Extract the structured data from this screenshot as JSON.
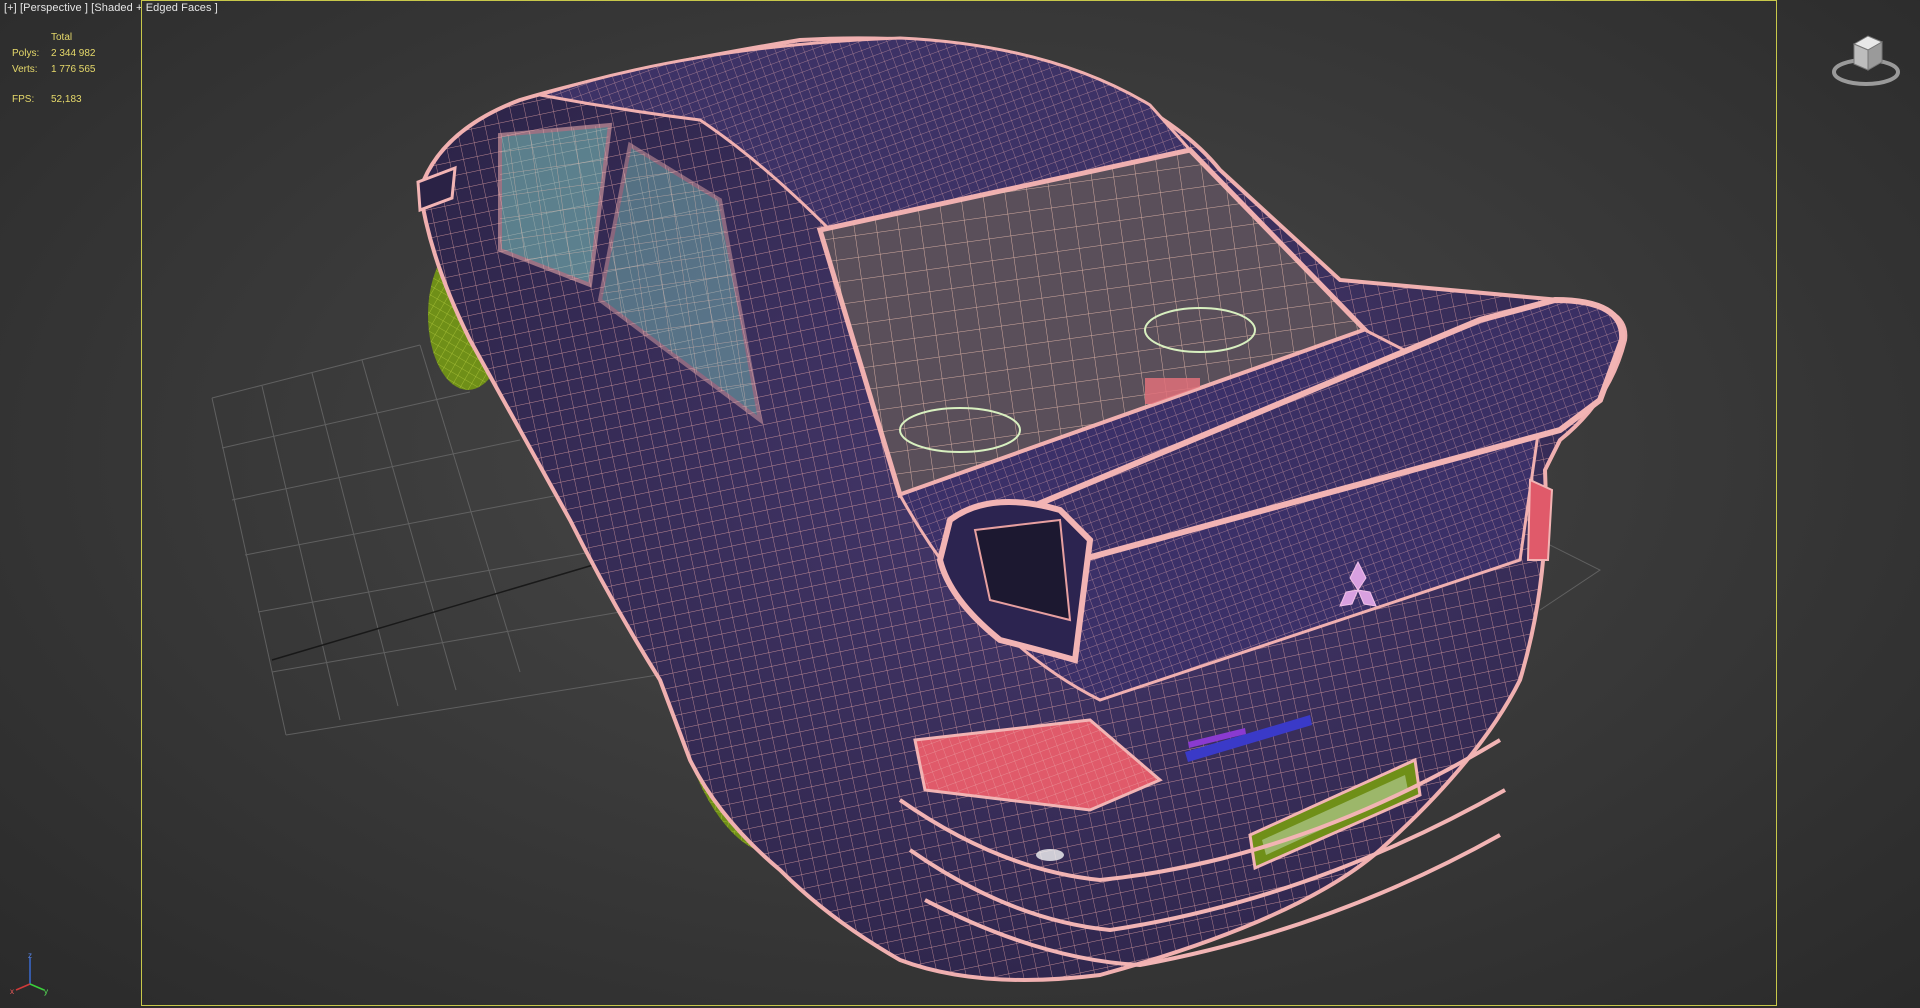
{
  "viewport": {
    "label": "[+] [Perspective ] [Shaded + Edged Faces ]",
    "view": "Perspective",
    "shading_mode": "Shaded + Edged Faces"
  },
  "stats": {
    "header": "Total",
    "polys_label": "Polys:",
    "polys_value": "2 344 982",
    "verts_label": "Verts:",
    "verts_value": "1 776 565",
    "fps_label": "FPS:",
    "fps_value": "52,183"
  },
  "viewcube": {
    "icon": "viewcube-icon"
  },
  "axis": {
    "x": "x",
    "y": "y",
    "z": "z"
  },
  "colors": {
    "background": "#3b3b3b",
    "stats_text": "#e6d96a",
    "safe_frame": "#c8c84a",
    "wire": "#e8a0a0",
    "body": "#3a2f5c",
    "wheels": "#7a9a1e",
    "taillight": "#e05a6a",
    "glass": "#8fd0c8"
  }
}
